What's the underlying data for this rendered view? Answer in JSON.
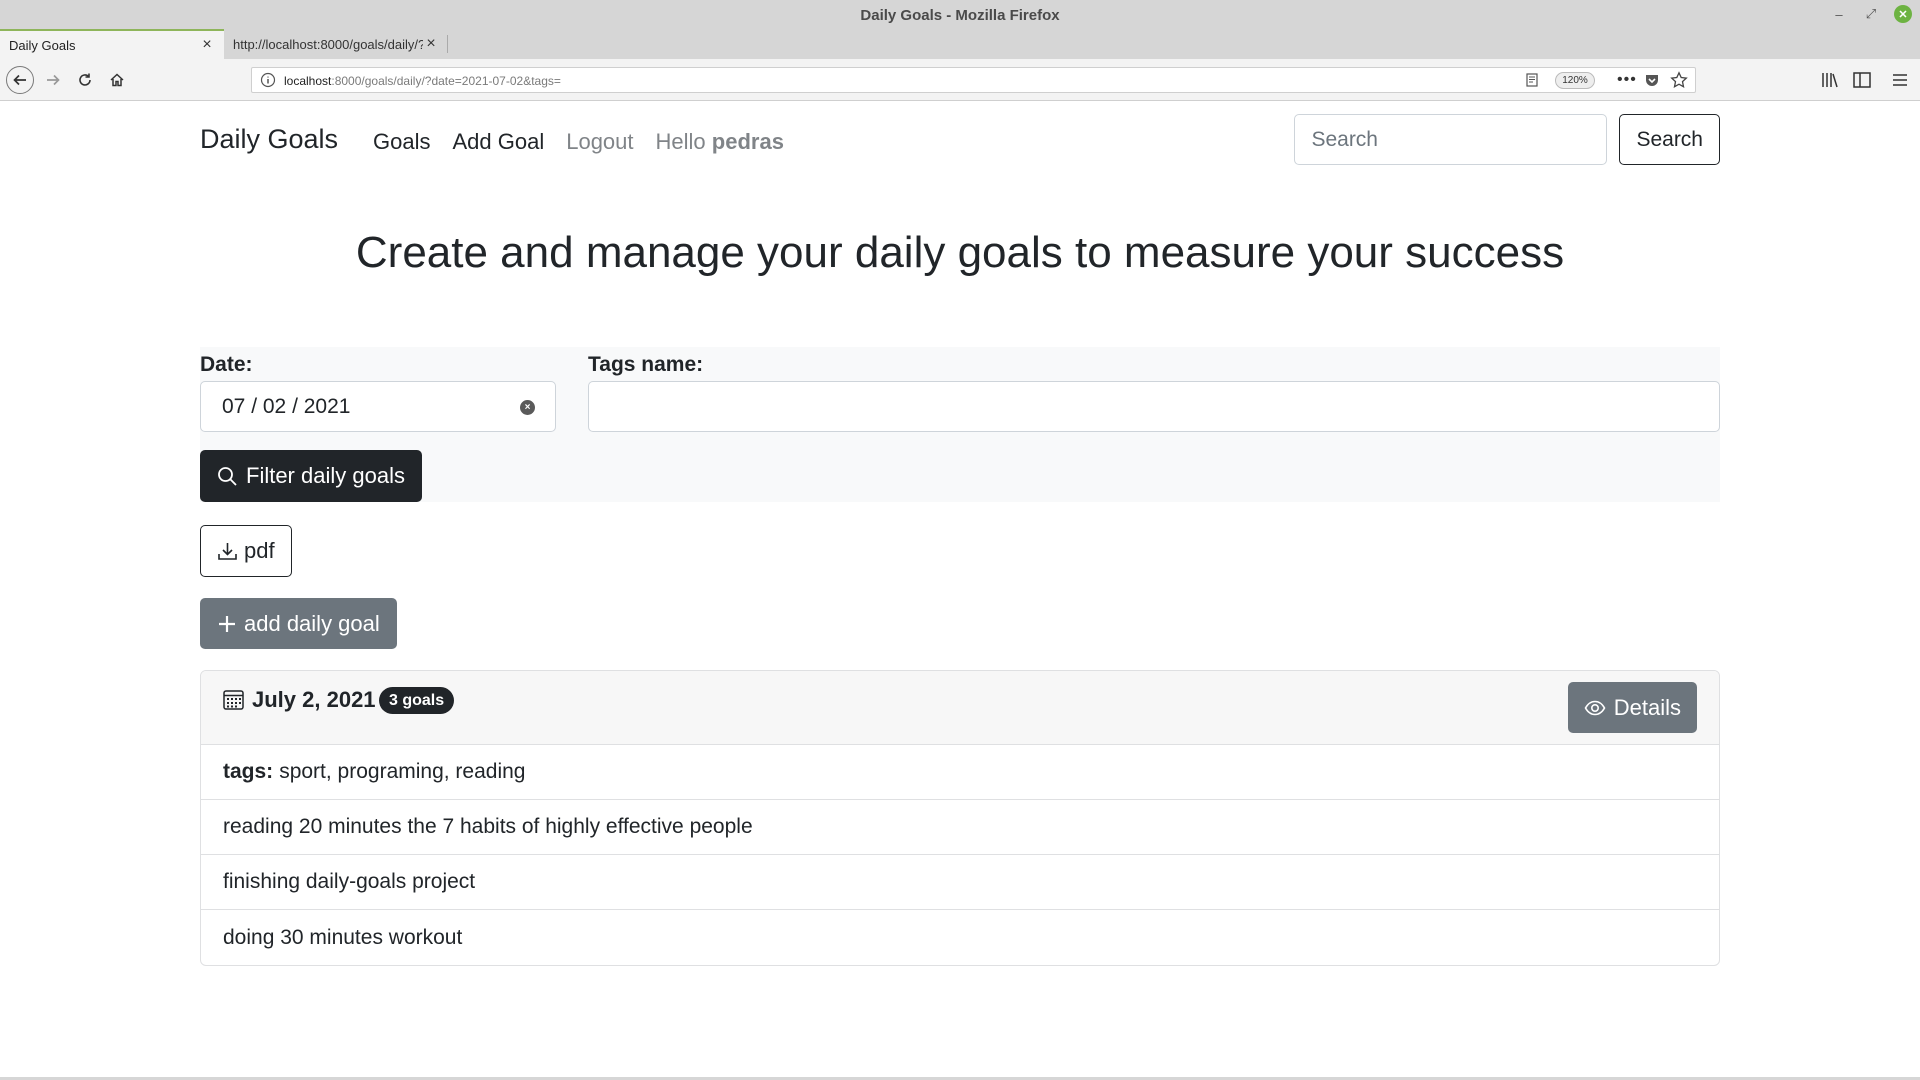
{
  "window": {
    "title": "Daily Goals - Mozilla Firefox"
  },
  "tabs": [
    {
      "label": "Daily Goals",
      "active": true
    },
    {
      "label": "http://localhost:8000/goals/daily/?",
      "active": false
    }
  ],
  "urlbar": {
    "host": "localhost",
    "path": ":8000/goals/daily/?date=2021-07-02&tags=",
    "zoom": "120%"
  },
  "nav": {
    "brand": "Daily Goals",
    "links": {
      "goals": "Goals",
      "add_goal": "Add Goal",
      "logout": "Logout"
    },
    "greeting": "Hello",
    "username": "pedras",
    "search_placeholder": "Search",
    "search_button": "Search"
  },
  "headline": "Create and manage your daily goals to measure your success",
  "filter": {
    "date_label": "Date:",
    "date_value": {
      "month": "07",
      "day": "02",
      "year": "2021"
    },
    "tags_label": "Tags name:",
    "tags_value": "",
    "filter_button": "Filter daily goals"
  },
  "actions": {
    "pdf_button": "pdf",
    "add_button": "add daily goal"
  },
  "day_card": {
    "date": "July 2, 2021",
    "goal_count_badge": "3 goals",
    "details_button": "Details",
    "tags_key": "tags:",
    "tags_value": "sport, programing, reading",
    "goals": [
      "reading 20 minutes the 7 habits of highly effective people",
      "finishing daily-goals project",
      "doing 30 minutes workout"
    ]
  },
  "colors": {
    "dark": "#212529",
    "secondary": "#6c757d",
    "muted_link": "#808488",
    "filter_bg": "#f8f9fa",
    "active_tab_accent": "#8eb55a"
  },
  "icons": [
    "back-icon",
    "forward-icon",
    "reload-icon",
    "home-icon",
    "info-icon",
    "reader-icon",
    "more-icon",
    "pocket-icon",
    "star-icon",
    "library-icon",
    "sidebar-icon",
    "menu-icon",
    "search-icon",
    "download-icon",
    "plus-icon",
    "calendar-icon",
    "eye-icon"
  ]
}
